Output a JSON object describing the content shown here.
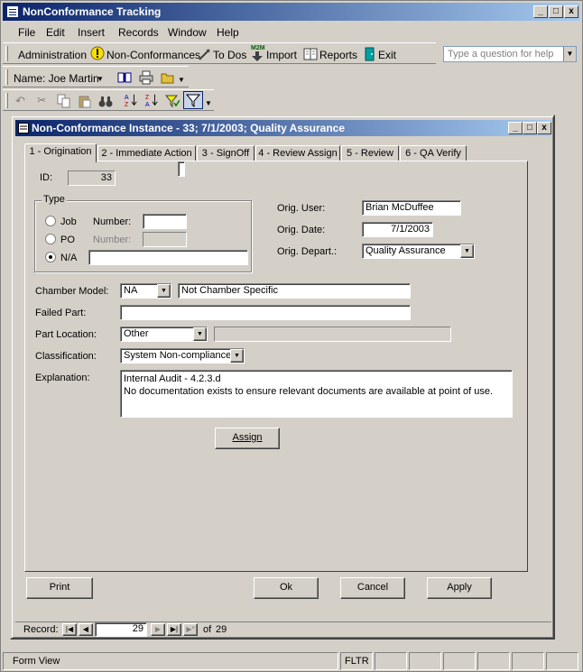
{
  "app": {
    "title": "NonConformance Tracking",
    "window_controls": [
      "_",
      "□",
      "x"
    ]
  },
  "menu": [
    "File",
    "Edit",
    "Insert",
    "Records",
    "Window",
    "Help"
  ],
  "toolbar1": {
    "administration": "Administration",
    "nonconformances": "Non-Conformances",
    "todos": "To Dos",
    "import": "Import",
    "reports": "Reports",
    "exit": "Exit",
    "m2m_badge": "M2M"
  },
  "help": {
    "placeholder": "Type a question for help"
  },
  "toolbar2": {
    "name_label": "Name: Joe Martin"
  },
  "form": {
    "title": "Non-Conformance Instance - 33; 7/1/2003; Quality Assurance",
    "tabs": [
      "1 - Origination",
      "2 - Immediate Action",
      "3 - SignOff",
      "4 - Review Assign",
      "5 - Review",
      "6 - QA Verify"
    ],
    "id_label": "ID:",
    "id_value": "33",
    "type_group": "Type",
    "type_job": "Job",
    "type_po": "PO",
    "type_na": "N/A",
    "number_label": "Number:",
    "number_label_disabled": "Number:",
    "job_number": "",
    "po_number": "",
    "na_text": "",
    "orig_user_label": "Orig. User:",
    "orig_user": "Brian McDuffee",
    "orig_date_label": "Orig. Date:",
    "orig_date": "7/1/2003",
    "orig_depart_label": "Orig. Depart.:",
    "orig_depart": "Quality Assurance",
    "chamber_model_label": "Chamber Model:",
    "chamber_model": "NA",
    "chamber_desc": "Not Chamber Specific",
    "failed_part_label": "Failed Part:",
    "failed_part": "",
    "part_location_label": "Part Location:",
    "part_location": "Other",
    "part_location_detail": "",
    "classification_label": "Classification:",
    "classification": "System Non-compliance",
    "explanation_label": "Explanation:",
    "explanation_line1": "Internal Audit - 4.2.3.d",
    "explanation_line2": "No documentation exists to ensure relevant documents are available at point of use.",
    "assign_button": "Assign",
    "print_button": "Print",
    "ok_button": "Ok",
    "cancel_button": "Cancel",
    "apply_button": "Apply"
  },
  "navigator": {
    "record_label": "Record:",
    "current": "29",
    "of_label": "of",
    "total": "29"
  },
  "status": {
    "view": "Form View",
    "filter": "FLTR"
  }
}
